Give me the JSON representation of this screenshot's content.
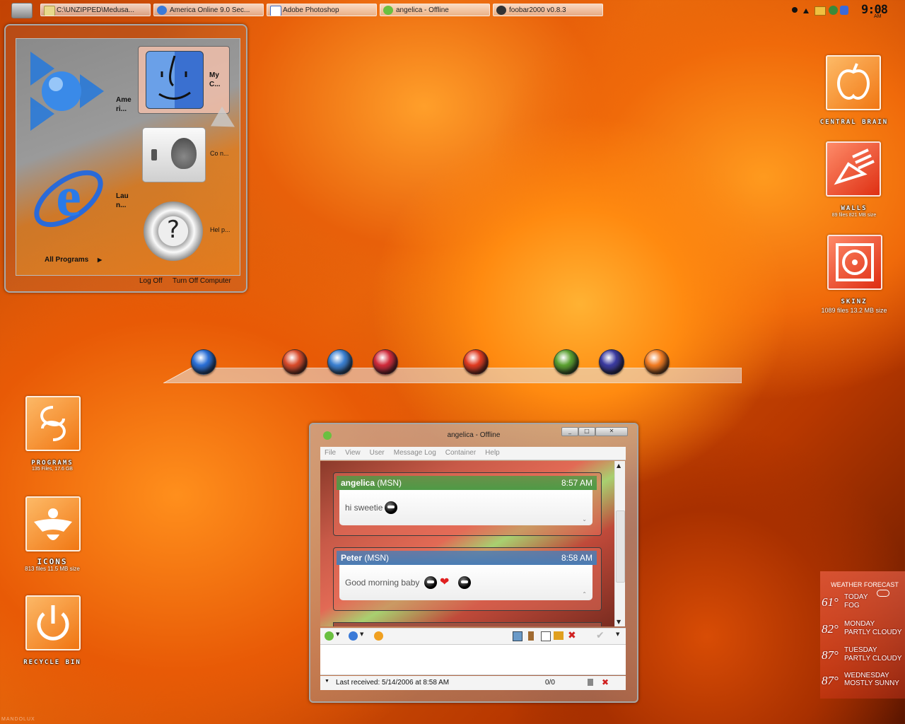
{
  "taskbar": {
    "tasks": [
      {
        "label": "C:\\UNZIPPED\\Medusa..."
      },
      {
        "label": "America Online 9.0 Sec..."
      },
      {
        "label": "Adobe Photoshop"
      },
      {
        "label": "angelica - Offline"
      },
      {
        "label": "foobar2000 v0.8.3"
      }
    ],
    "clock": "9:08",
    "clock_ampm": "AM"
  },
  "start_menu": {
    "pinned_left": [
      {
        "label": "Ame ri...",
        "icon": "aol-icon"
      },
      {
        "label": "Lau n...",
        "icon": "internet-explorer-icon"
      }
    ],
    "pinned_right": [
      {
        "label": "My C...",
        "icon": "finder-icon"
      },
      {
        "label": "Co n...",
        "icon": "control-panel-icon"
      },
      {
        "label": "Hel p...",
        "icon": "help-icon"
      }
    ],
    "all_programs": "All Programs",
    "log_off": "Log Off",
    "turn_off": "Turn Off Computer"
  },
  "desktop_icons_right": [
    {
      "label": "CENTRAL BRAIN",
      "sub": "",
      "icon": "apple-outline-icon"
    },
    {
      "label": "WALLS",
      "sub": "89 files 821 MB size",
      "icon": "bell-icon"
    },
    {
      "label": "SKINZ",
      "sub": "1089 files 13.2 MB size",
      "icon": "cd-icon"
    }
  ],
  "desktop_icons_left": [
    {
      "label": "PROGRAMS",
      "sub": "135 Files, 17.6 GB",
      "icon": "spiral-icon"
    },
    {
      "label": "ICONS",
      "sub": "813 files 11.5 MB size",
      "icon": "emblem-icon"
    },
    {
      "label": "RECYCLE BIN",
      "sub": "",
      "icon": "power-icon"
    }
  ],
  "dock": {
    "items": [
      {
        "name": "internet-explorer-dock-icon",
        "color": "#2a6fd6"
      },
      {
        "name": "flower-orb-1-dock-icon",
        "color": "#d84a2a"
      },
      {
        "name": "flower-orb-2-dock-icon",
        "color": "#3a7fd0"
      },
      {
        "name": "flower-orb-3-dock-icon",
        "color": "#d02a3a"
      },
      {
        "name": "flower-orb-4-dock-icon",
        "color": "#e03a20"
      },
      {
        "name": "flower-orb-5-dock-icon",
        "color": "#5aa030"
      },
      {
        "name": "star-orb-dock-icon",
        "color": "#3a3aa0"
      },
      {
        "name": "flower-orb-6-dock-icon",
        "color": "#f07a20"
      }
    ]
  },
  "chat": {
    "title": "angelica - Offline",
    "menu": [
      "File",
      "View",
      "User",
      "Message Log",
      "Container",
      "Help"
    ],
    "messages": [
      {
        "sender": "angelica",
        "proto": "(MSN)",
        "time": "8:57 AM",
        "text": "hi sweetie",
        "header_color": "#4e9a46"
      },
      {
        "sender": "Peter",
        "proto": "(MSN)",
        "time": "8:58 AM",
        "text": "Good morning baby",
        "header_color": "#4a7db5"
      }
    ],
    "status_last_received": "Last received: 5/14/2006 at 8:58 AM",
    "status_count": "0/0"
  },
  "weather": {
    "title": "WEATHER FORECAST",
    "days": [
      {
        "temp": "61°",
        "day": "TODAY",
        "cond": "FOG"
      },
      {
        "temp": "82°",
        "day": "MONDAY",
        "cond": "PARTLY CLOUDY"
      },
      {
        "temp": "87°",
        "day": "TUESDAY",
        "cond": "PARTLY CLOUDY"
      },
      {
        "temp": "87°",
        "day": "WEDNESDAY",
        "cond": "MOSTLY SUNNY"
      }
    ]
  },
  "watermark": "MANDOLUX"
}
